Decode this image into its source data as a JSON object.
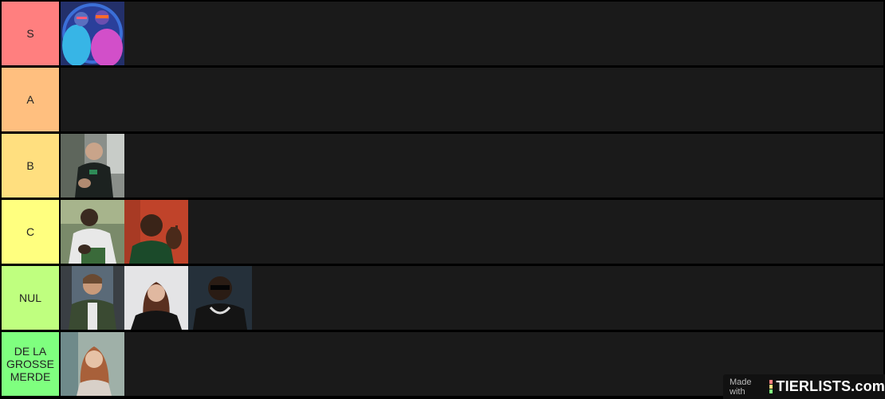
{
  "tiers": [
    {
      "label": "S",
      "color": "#ff7f7f",
      "items": [
        "s-1"
      ]
    },
    {
      "label": "A",
      "color": "#ffbf7f",
      "items": []
    },
    {
      "label": "B",
      "color": "#ffdf7f",
      "items": [
        "b-1"
      ]
    },
    {
      "label": "C",
      "color": "#ffff7f",
      "items": [
        "c-1",
        "c-2"
      ]
    },
    {
      "label": "NUL",
      "color": "#bfff7f",
      "items": [
        "nul-1",
        "nul-2",
        "nul-3"
      ]
    },
    {
      "label": "DE LA GROSSE MERDE",
      "color": "#7fff7f",
      "items": [
        "merde-1"
      ]
    }
  ],
  "watermark": {
    "made_with": "Made with",
    "brand": "TIERLISTS.com"
  }
}
